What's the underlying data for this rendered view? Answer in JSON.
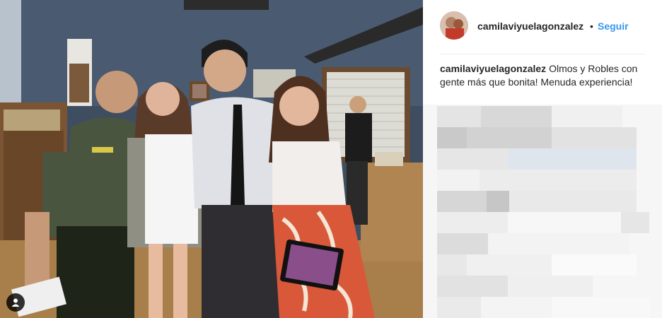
{
  "post": {
    "username": "camilaviyuelagonzalez",
    "separator": "•",
    "follow_label": "Seguir",
    "caption_username": "camilaviyuelagonzalez",
    "caption_text": "Olmos y Robles con gente más que bonita! Menuda experiencia!"
  },
  "icons": {
    "tag": "user-tag-icon"
  },
  "colors": {
    "follow_blue": "#3897f0",
    "text_dark": "#262626",
    "divider": "#efefef"
  }
}
